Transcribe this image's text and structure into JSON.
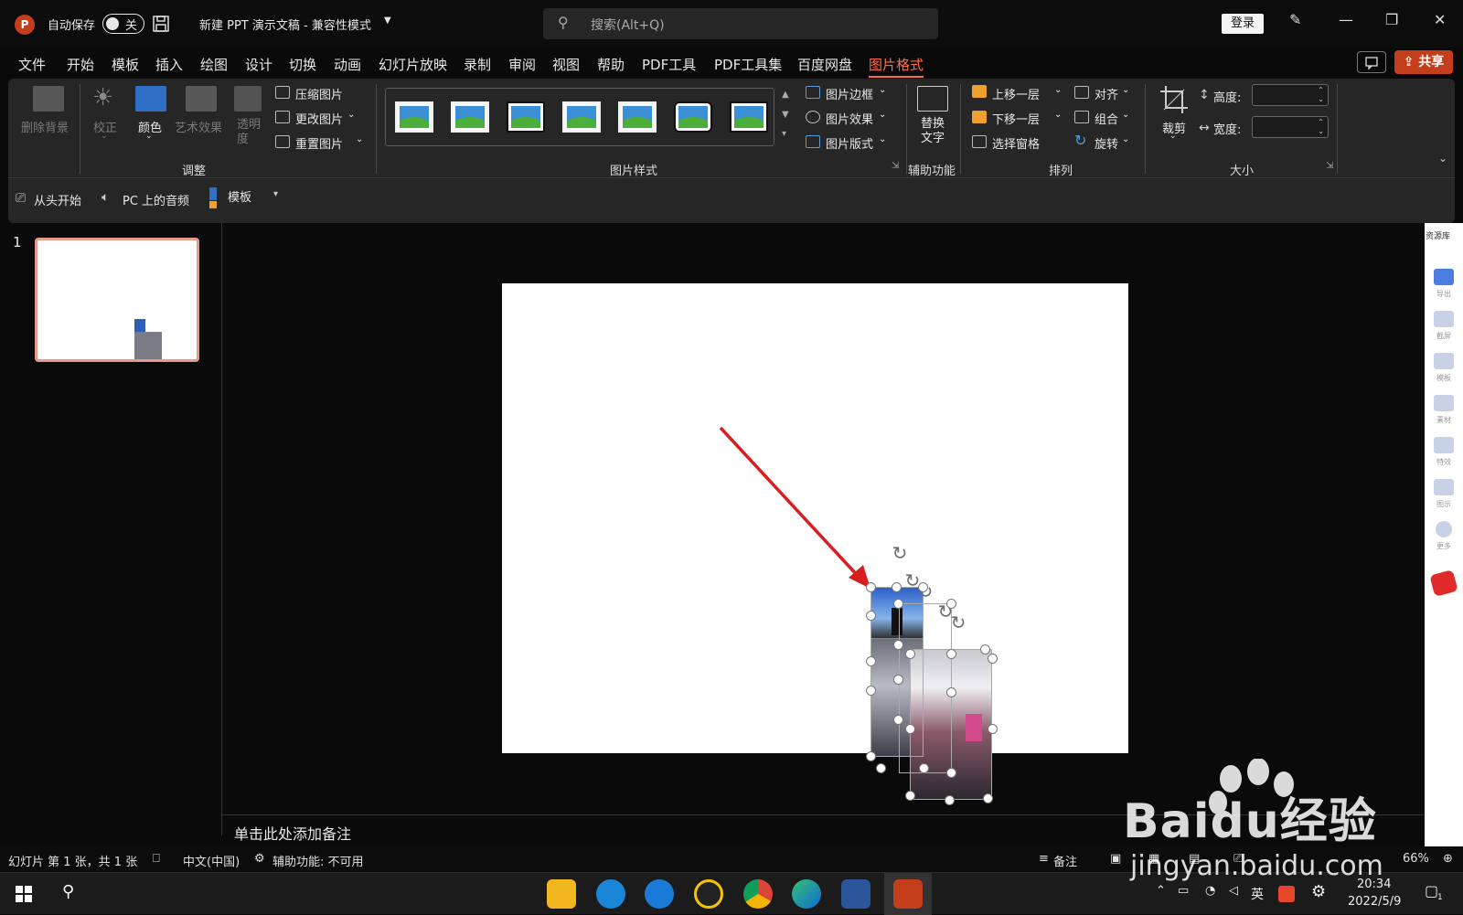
{
  "titlebar": {
    "autosave_label": "自动保存",
    "autosave_state": "关",
    "doc_title": "新建 PPT 演示文稿  -  兼容性模式",
    "search_placeholder": "搜索(Alt+Q)",
    "login_label": "登录"
  },
  "menu": {
    "items": [
      "文件",
      "开始",
      "模板",
      "插入",
      "绘图",
      "设计",
      "切换",
      "动画",
      "幻灯片放映",
      "录制",
      "审阅",
      "视图",
      "帮助",
      "PDF工具",
      "PDF工具集",
      "百度网盘",
      "图片格式"
    ],
    "active_index": 16,
    "share_label": "共享"
  },
  "ribbon": {
    "adjust": {
      "remove_bg": "删除背景",
      "correct": "校正",
      "color": "颜色",
      "art_effect": "艺术效果",
      "transparency": "透明\n度",
      "compress": "压缩图片",
      "change": "更改图片",
      "reset": "重置图片",
      "group_label": "调整"
    },
    "styles": {
      "border": "图片边框",
      "effect": "图片效果",
      "layout": "图片版式",
      "group_label": "图片样式"
    },
    "accessibility": {
      "alt_text": "替换\n文字",
      "group_label": "辅助功能"
    },
    "arrange": {
      "bring_forward": "上移一层",
      "send_backward": "下移一层",
      "selection_pane": "选择窗格",
      "align": "对齐",
      "group": "组合",
      "rotate": "旋转",
      "group_label": "排列"
    },
    "size": {
      "crop": "裁剪",
      "height_label": "高度:",
      "width_label": "宽度:",
      "group_label": "大小"
    }
  },
  "qat": {
    "from_start": "从头开始",
    "pc_audio": "PC 上的音频",
    "template": "模板"
  },
  "slides": {
    "number": "1"
  },
  "notes_placeholder": "单击此处添加备注",
  "right_pane": {
    "title": "资源库",
    "items": [
      "导出",
      "截屏",
      "模板",
      "素材",
      "特效",
      "图示",
      "更多"
    ]
  },
  "status": {
    "slide_info": "幻灯片 第 1 张，共 1 张",
    "language": "中文(中国)",
    "accessibility": "辅助功能: 不可用",
    "notes": "备注",
    "zoom": "66%"
  },
  "taskbar": {
    "ime": "英",
    "time": "20:34",
    "date": "2022/5/9",
    "notif_count": "1"
  },
  "watermark": {
    "brand_text": "Baidu经验",
    "url": "jingyan.baidu.com"
  },
  "colors": {
    "accent": "#c43e1c",
    "active_tab": "#ff6b4a",
    "arrow": "#d81e1e"
  }
}
